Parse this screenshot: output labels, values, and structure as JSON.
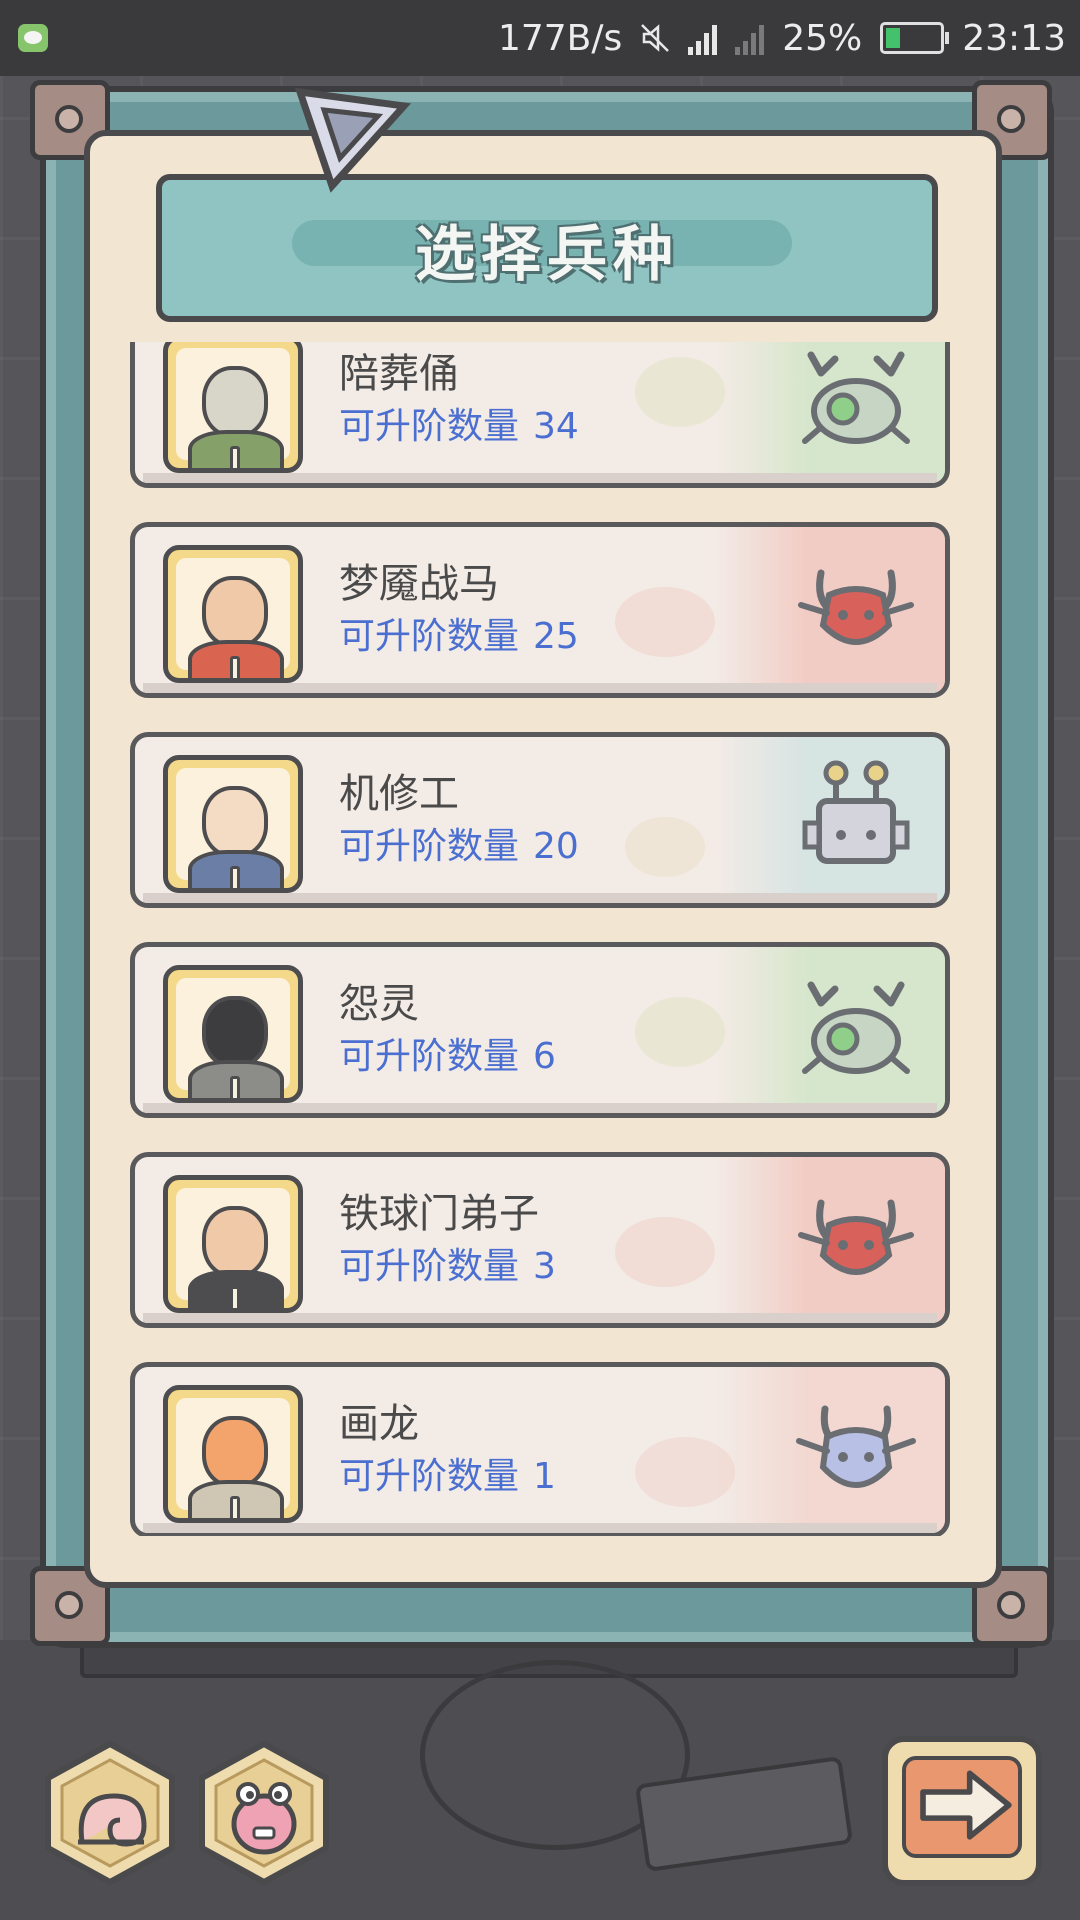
{
  "status_bar": {
    "speed": "177B/s",
    "network": "4G",
    "battery_percent": "25%",
    "time": "23:13",
    "icons": [
      "wechat-icon",
      "mute-icon",
      "signal-icon",
      "battery-icon"
    ]
  },
  "dialog": {
    "title": "选择兵种"
  },
  "upgrade_label": "可升阶数量",
  "units": [
    {
      "name": "陪葬俑",
      "count": "34",
      "type_icon": "crab-type-icon",
      "color": "#bfe2b6"
    },
    {
      "name": "梦魇战马",
      "count": "25",
      "type_icon": "demon-type-icon",
      "color": "#f0b7ad"
    },
    {
      "name": "机修工",
      "count": "20",
      "type_icon": "robot-type-icon",
      "color": "#c3dfe0"
    },
    {
      "name": "怨灵",
      "count": "6",
      "type_icon": "crab-type-icon",
      "color": "#bfe2b6"
    },
    {
      "name": "铁球门弟子",
      "count": "3",
      "type_icon": "demon-type-icon",
      "color": "#f0b7ad"
    },
    {
      "name": "画龙",
      "count": "1",
      "type_icon": "dragon-type-icon",
      "color": "#f2c9bf"
    }
  ],
  "buttons": {
    "shell": "shell-button",
    "creature": "creature-button",
    "next": "next-arrow-button"
  }
}
